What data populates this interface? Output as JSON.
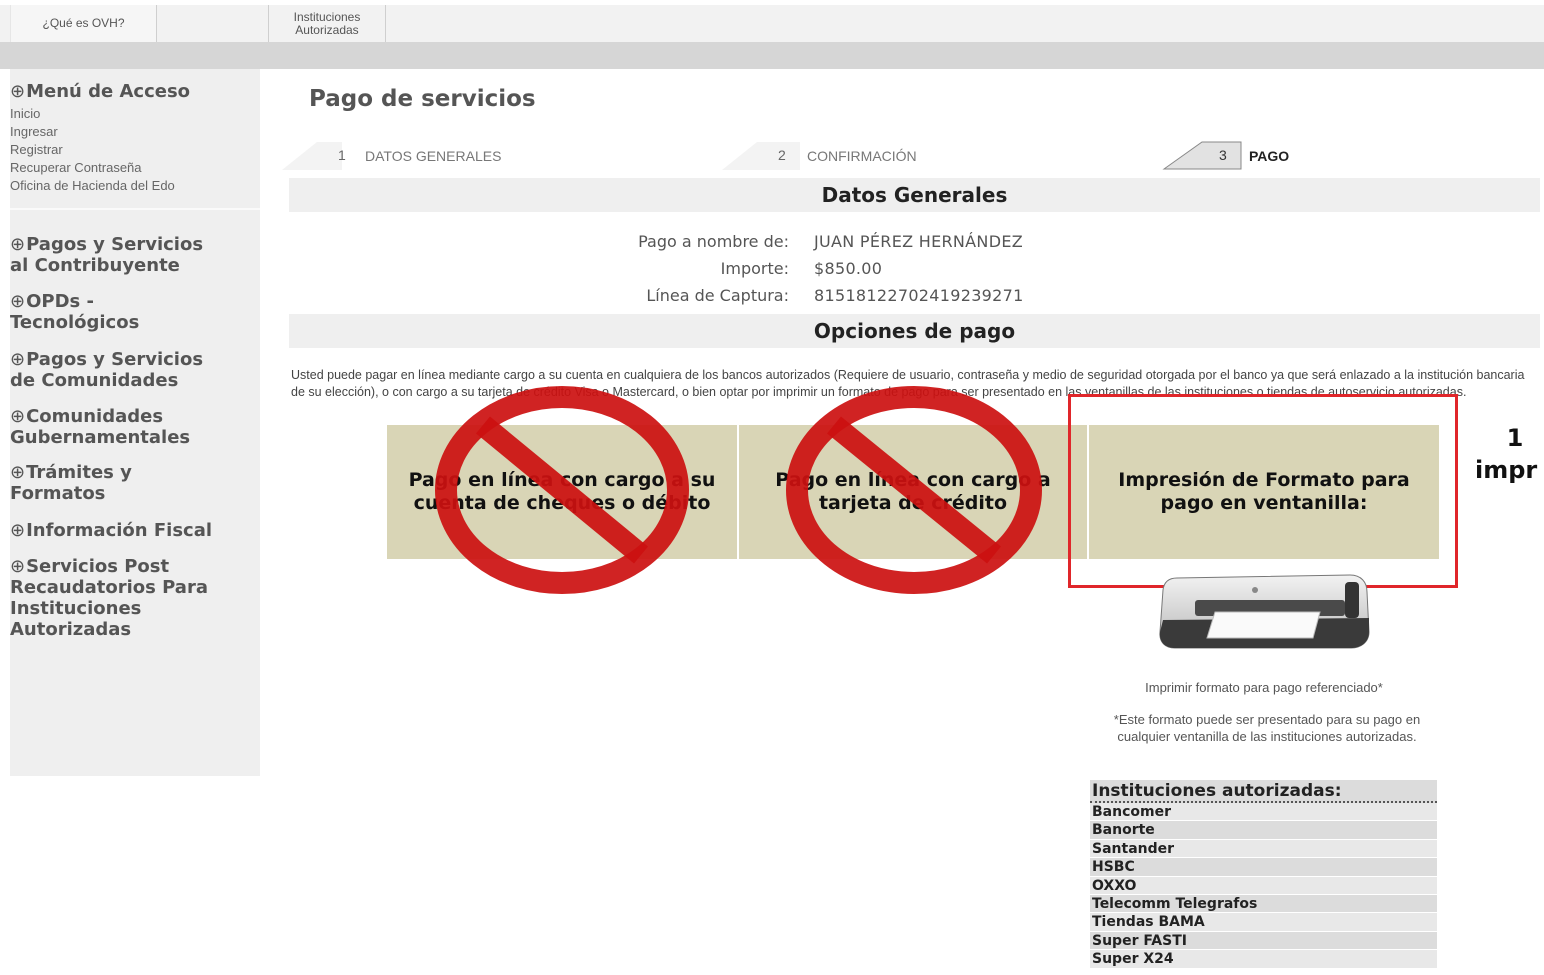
{
  "topnav": {
    "tab1": "¿Qué es OVH?",
    "tab2_line1": "Instituciones",
    "tab2_line2": "Autorizadas"
  },
  "sidebar": {
    "menu_title": "Menú de Acceso",
    "links": [
      "Inicio",
      "Ingresar",
      "Registrar",
      "Recuperar Contraseña",
      "Oficina de Hacienda del Edo"
    ],
    "sections": [
      [
        "Pagos y Servicios",
        "al Contribuyente"
      ],
      [
        "OPDs -",
        "Tecnológicos"
      ],
      [
        "Pagos y Servicios",
        "de Comunidades"
      ],
      [
        "Comunidades",
        "Gubernamentales"
      ],
      [
        "Trámites y",
        "Formatos"
      ],
      [
        "Información Fiscal"
      ],
      [
        "Servicios Post",
        "Recaudatorios Para",
        "Instituciones",
        "Autorizadas"
      ]
    ]
  },
  "main": {
    "title": "Pago de servicios",
    "steps": [
      {
        "num": "1",
        "label": "DATOS GENERALES"
      },
      {
        "num": "2",
        "label": "CONFIRMACIÓN"
      },
      {
        "num": "3",
        "label": "PAGO"
      }
    ],
    "datos_generales_header": "Datos Generales",
    "fields": [
      {
        "label": "Pago a nombre de:",
        "value": "JUAN PÉREZ HERNÁNDEZ"
      },
      {
        "label": "Importe:",
        "value": "$850.00"
      },
      {
        "label": "Línea de Captura:",
        "value": "81518122702419239271"
      }
    ],
    "opciones_header": "Opciones de pago",
    "intro_text": "Usted puede pagar en línea mediante cargo a su cuenta en cualquiera de los bancos autorizados (Requiere de usuario, contraseña y medio de seguridad otorgada por el banco ya que será enlazado a la institución bancaria de su elección), o con cargo a su tarjeta de crédito Visa o Mastercard, o bien optar por imprimir un formato de pago para ser presentado en las ventanillas de las instituciones o tiendas de autoservicio autorizadas.",
    "options": [
      "Pago en línea con cargo a su cuenta de cheques o débito",
      "Pago en línea con cargo a tarjeta de crédito",
      "Impresión de Formato para pago en ventanilla:"
    ],
    "step_hint_line1": "1",
    "step_hint_line2": "impr",
    "print_link": "Imprimir formato para pago referenciado*",
    "print_note": "*Este formato puede ser presentado para su pago en cualquier ventanilla de las instituciones autorizadas.",
    "institutions_header": "Instituciones autorizadas:",
    "institutions": [
      "Bancomer",
      "Banorte",
      "Santander",
      "HSBC",
      "OXXO",
      "Telecomm Telegrafos",
      "Tiendas BAMA",
      "Super FASTI",
      "Super X24"
    ]
  },
  "colors": {
    "highlight": "#e0262a",
    "prohibit_red": "#cc1010",
    "option_bg": "#d9d5b6"
  },
  "icons": {
    "menu_arrow": "circle-arrow-down-icon",
    "section_arrow": "circle-arrow-right-icon",
    "printer": "printer-icon",
    "prohibited": "prohibited-icon"
  }
}
